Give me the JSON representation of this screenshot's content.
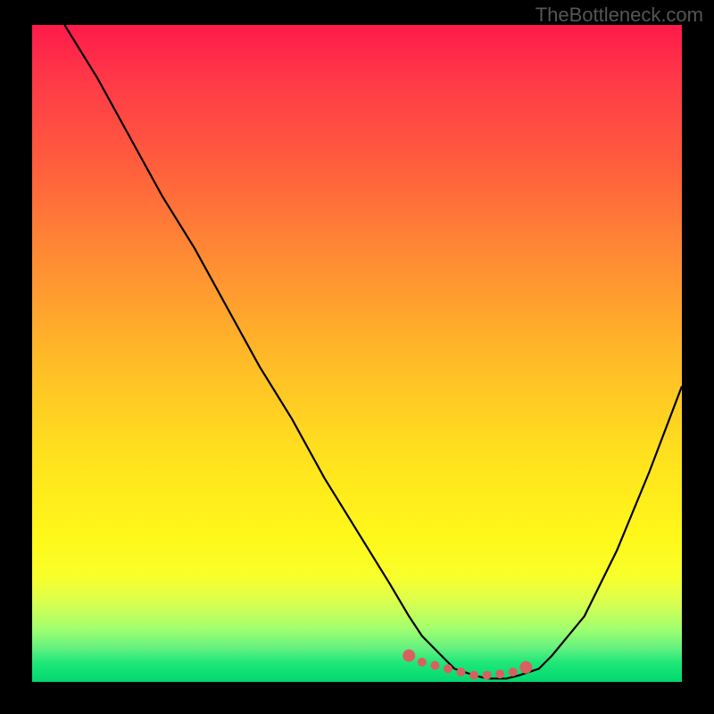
{
  "watermark": "TheBottleneck.com",
  "chart_data": {
    "type": "line",
    "title": "",
    "xlabel": "",
    "ylabel": "",
    "xlim": [
      0,
      100
    ],
    "ylim": [
      0,
      100
    ],
    "series": [
      {
        "name": "curve",
        "x": [
          5,
          10,
          15,
          20,
          25,
          30,
          35,
          40,
          45,
          50,
          55,
          58,
          60,
          63,
          65,
          68,
          70,
          73,
          75,
          78,
          80,
          85,
          90,
          95,
          100
        ],
        "y": [
          100,
          92,
          83,
          74,
          66,
          57,
          48,
          40,
          31,
          23,
          15,
          10,
          7,
          4,
          2,
          1,
          0.5,
          0.5,
          1,
          2,
          4,
          10,
          20,
          32,
          45
        ]
      }
    ],
    "markers": {
      "name": "highlight",
      "x": [
        58,
        60,
        62,
        64,
        66,
        68,
        70,
        72,
        74,
        76
      ],
      "y": [
        4,
        3,
        2.5,
        2,
        1.5,
        1,
        1,
        1.2,
        1.5,
        2.2
      ]
    }
  }
}
